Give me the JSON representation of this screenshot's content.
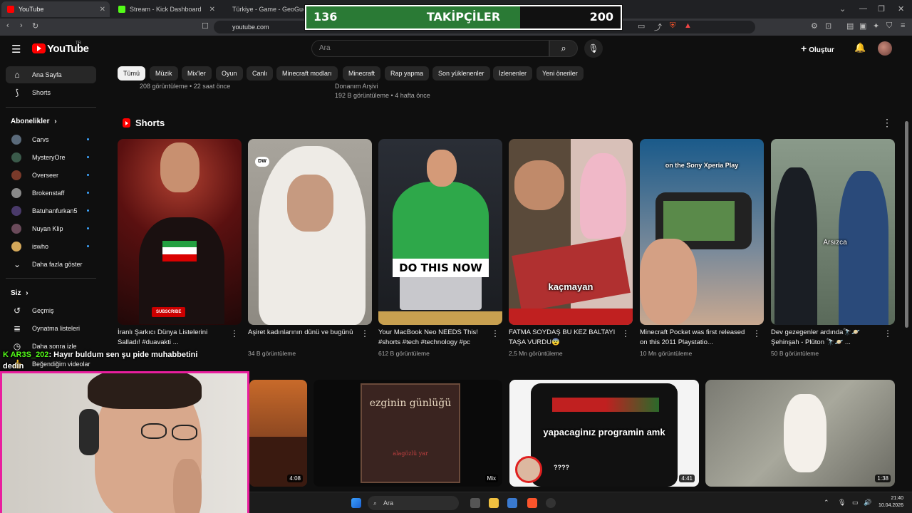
{
  "browser": {
    "tabs": [
      {
        "title": "YouTube",
        "color": "#ff0000"
      },
      {
        "title": "Stream - Kick Dashboard",
        "color": "#53fc18"
      },
      {
        "title": "Türkiye - Game - GeoGuessr",
        "color": "#e03c3c"
      }
    ],
    "url": "youtube.com"
  },
  "overlay": {
    "current": "136",
    "label": "TAKİPÇİLER",
    "goal": "200",
    "progress_fraction": 0.68,
    "fill_color": "#2a7a35"
  },
  "header": {
    "logo": "YouTube",
    "logo_region": "TR",
    "search_placeholder": "Ara",
    "create_label": "Oluştur"
  },
  "sidebar": {
    "home": "Ana Sayfa",
    "shorts": "Shorts",
    "subs_heading": "Abonelikler",
    "channels": [
      {
        "name": "Carvs",
        "color": "#5a6a7a"
      },
      {
        "name": "MysteryOre",
        "color": "#3a5a4a"
      },
      {
        "name": "Overseer",
        "color": "#7a3a2a"
      },
      {
        "name": "Brokenstaff",
        "color": "#8a8a8a"
      },
      {
        "name": "Batuhanfurkan5",
        "color": "#4a3a6a"
      },
      {
        "name": "Nuyan Klip",
        "color": "#6a4a5a"
      },
      {
        "name": "iswho",
        "color": "#d4a85a"
      }
    ],
    "show_more": "Daha fazla göster",
    "you_heading": "Siz",
    "you_items": [
      "Geçmiş",
      "Oynatma listeleri",
      "Daha sonra izle",
      "Beğendiğim videolar"
    ]
  },
  "chips": [
    "Tümü",
    "Müzik",
    "Mix'ler",
    "Oyun",
    "Canlı",
    "Minecraft modları",
    "Minecraft",
    "Rap yapma",
    "Son yüklenenler",
    "İzlenenler",
    "Yeni öneriler"
  ],
  "above_fold": {
    "left_meta": "208 görüntüleme • 22 saat önce",
    "right_channel": "Donanım Arşivi",
    "right_meta": "192 B görüntüleme • 4 hafta önce"
  },
  "shorts": {
    "heading": "Shorts",
    "items": [
      {
        "title": "İranlı Şarkıcı Dünya Listelerini Salladı! #duavakti ...",
        "views": "",
        "caption": "SUBSCRIBE"
      },
      {
        "title": "Aşiret kadınlarının dünü ve bugünü",
        "views": "34 B görüntüleme",
        "caption": ""
      },
      {
        "title": "Your MacBook Neo NEEDS This! #shorts #tech #technology #pc",
        "views": "612 B görüntüleme",
        "caption": "DO THIS NOW"
      },
      {
        "title": "FATMA SOYDAŞ BU KEZ BALTAYI TAŞA VURDU😨",
        "views": "2,5 Mn görüntüleme",
        "caption": "kaçmayan"
      },
      {
        "title": "Minecraft Pocket was first released on this 2011 Playstatio...",
        "views": "10 Mn görüntüleme",
        "caption": "on the Sony Xperia Play"
      },
      {
        "title": "Dev gezegenler ardında🔭🪐 Şehinşah - Plüton 🔭🪐 ...",
        "views": "50 B görüntüleme",
        "caption": "Arsızca"
      }
    ]
  },
  "videos": [
    {
      "duration": "4:08",
      "caption": ""
    },
    {
      "duration": "Mix",
      "caption": "ezginin günlüğü",
      "sub": "alagözlü yar"
    },
    {
      "duration": "4:41",
      "caption": "yapacaginız programin amk",
      "sub": "????"
    },
    {
      "duration": "1:38",
      "caption": ""
    }
  ],
  "chat": {
    "user": "AR3S_202",
    "message": ": Hayır buldum sen şu pide muhabbetini dedin"
  },
  "taskbar": {
    "search_placeholder": "Ara",
    "time": "21:40",
    "date": "10.04.2026"
  }
}
